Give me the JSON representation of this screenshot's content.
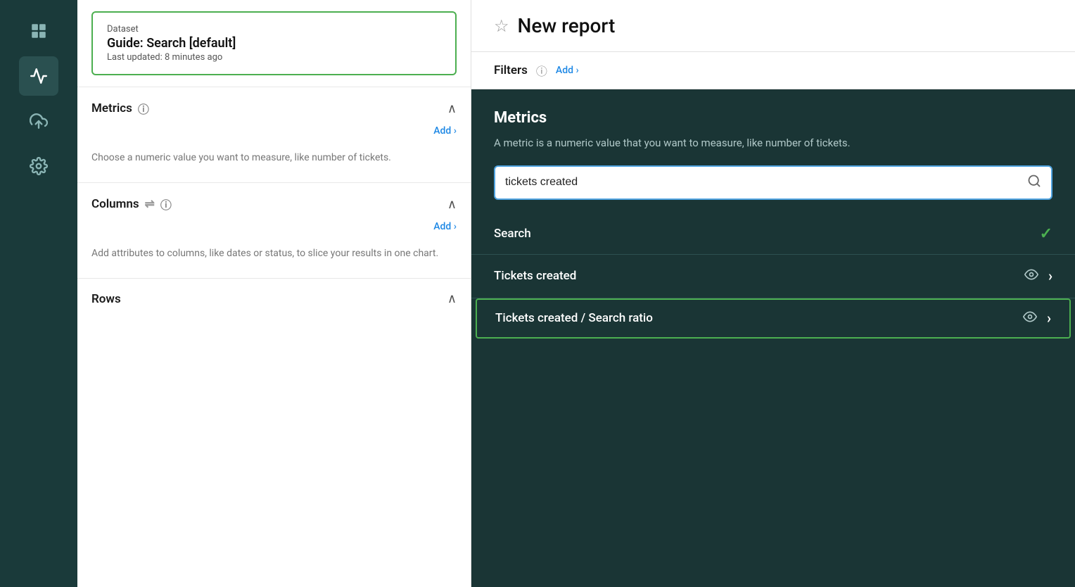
{
  "sidebar": {
    "icons": [
      {
        "name": "grid-icon",
        "symbol": "⊞",
        "active": false
      },
      {
        "name": "chart-icon",
        "symbol": "📈",
        "active": true
      },
      {
        "name": "upload-icon",
        "symbol": "⬆",
        "active": false
      },
      {
        "name": "gear-icon",
        "symbol": "⚙",
        "active": false
      }
    ]
  },
  "dataset": {
    "label": "Dataset",
    "name": "Guide: Search [default]",
    "updated": "Last updated: 8 minutes ago"
  },
  "left_panel": {
    "metrics": {
      "title": "Metrics",
      "add_label": "Add ›",
      "description": "Choose a numeric value you want to measure, like number of tickets."
    },
    "columns": {
      "title": "Columns",
      "add_label": "Add ›",
      "description": "Add attributes to columns, like dates or status, to slice your results in one chart."
    },
    "rows": {
      "title": "Rows"
    }
  },
  "report": {
    "title": "New report",
    "star_label": "☆"
  },
  "filters": {
    "label": "Filters",
    "info_icon": "ⓘ",
    "add_label": "Add ›"
  },
  "dropdown": {
    "metrics_title": "Metrics",
    "metrics_desc": "A metric is a numeric value that you want to measure, like number of tickets.",
    "search_placeholder": "tickets created",
    "search_section_label": "Search",
    "results": [
      {
        "label": "Tickets created",
        "highlighted": false
      },
      {
        "label": "Tickets created / Search ratio",
        "highlighted": true
      }
    ]
  }
}
